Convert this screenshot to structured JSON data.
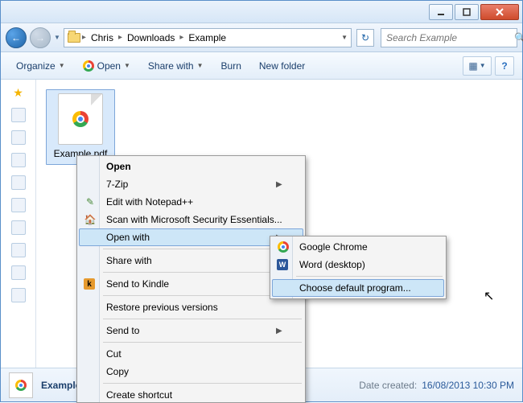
{
  "breadcrumb": [
    "Chris",
    "Downloads",
    "Example"
  ],
  "search_placeholder": "Search Example",
  "toolbar": {
    "organize": "Organize",
    "open": "Open",
    "share": "Share with",
    "burn": "Burn",
    "newfolder": "New folder"
  },
  "file": {
    "name": "Example.pdf"
  },
  "status": {
    "date_label": "Date created:",
    "date_value": "16/08/2013 10:30 PM"
  },
  "ctx": {
    "open": "Open",
    "sevenzip": "7-Zip",
    "notepad": "Edit with Notepad++",
    "scan": "Scan with Microsoft Security Essentials...",
    "openwith": "Open with",
    "sharewith": "Share with",
    "kindle": "Send to Kindle",
    "restore": "Restore previous versions",
    "sendto": "Send to",
    "cut": "Cut",
    "copy": "Copy",
    "createshortcut": "Create shortcut"
  },
  "submenu": {
    "chrome": "Google Chrome",
    "word": "Word (desktop)",
    "choose": "Choose default program..."
  }
}
